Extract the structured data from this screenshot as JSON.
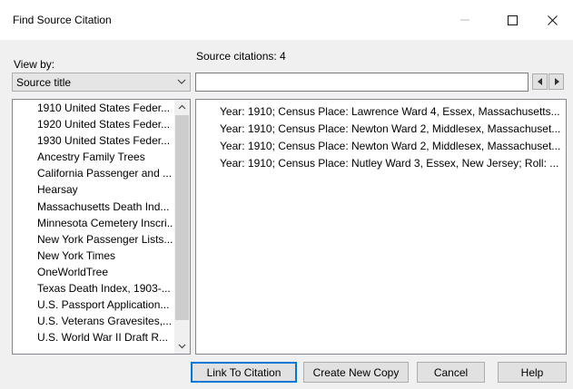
{
  "window": {
    "title": "Find Source Citation",
    "controls": {
      "minimize_icon": "minimize-icon",
      "maximize_icon": "maximize-icon",
      "close_icon": "close-icon"
    }
  },
  "view_by": {
    "label": "View by:",
    "selected": "Source title"
  },
  "citations_header": "Source citations: 4",
  "search": {
    "value": "",
    "placeholder": ""
  },
  "sources": [
    "1910 United States Feder...",
    "1920 United States Feder...",
    "1930 United States Feder...",
    "Ancestry Family Trees",
    "California Passenger and ...",
    "Hearsay",
    "Massachusetts Death Ind...",
    "Minnesota Cemetery Inscri...",
    "New York Passenger Lists...",
    "New York Times",
    "OneWorldTree",
    "Texas Death Index, 1903-...",
    "U.S. Passport Application...",
    "U.S. Veterans Gravesites,...",
    "U.S. World War II Draft R..."
  ],
  "citations": [
    "Year: 1910; Census Place: Lawrence Ward 4, Essex, Massachusetts...",
    "Year: 1910; Census Place: Newton Ward 2, Middlesex, Massachuset...",
    "Year: 1910; Census Place: Newton Ward 2, Middlesex, Massachuset...",
    "Year: 1910; Census Place: Nutley Ward 3, Essex, New Jersey; Roll: ..."
  ],
  "buttons": {
    "link": "Link To Citation",
    "create": "Create New Copy",
    "cancel": "Cancel",
    "help": "Help"
  },
  "colors": {
    "dialog_bg": "#f0f0f0",
    "accent": "#0078d7",
    "border": "#adadad"
  }
}
